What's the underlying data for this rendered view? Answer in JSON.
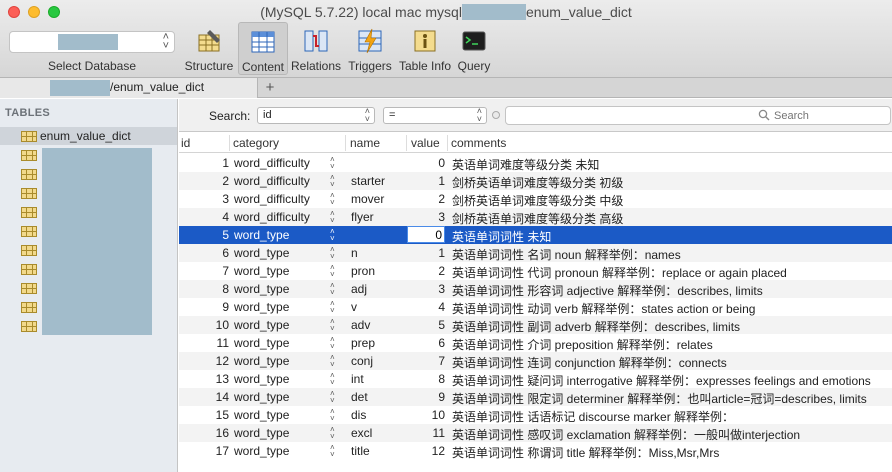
{
  "window": {
    "title_prefix": "(MySQL 5.7.22) local mac mysql",
    "title_suffix": "enum_value_dict"
  },
  "toolbar": {
    "select_database_label": "Select Database",
    "tools": [
      {
        "label": "Structure",
        "icon": "structure-icon"
      },
      {
        "label": "Content",
        "icon": "content-icon",
        "active": true
      },
      {
        "label": "Relations",
        "icon": "relations-icon"
      },
      {
        "label": "Triggers",
        "icon": "triggers-icon"
      },
      {
        "label": "Table Info",
        "icon": "table-info-icon"
      },
      {
        "label": "Query",
        "icon": "query-icon"
      }
    ]
  },
  "tab": {
    "label": "/enum_value_dict",
    "add": "+"
  },
  "sidebar": {
    "heading": "TABLES",
    "selected_table": "enum_value_dict",
    "other_table_count": 11
  },
  "filter": {
    "label": "Search:",
    "field": "id",
    "operator": "=",
    "search_placeholder": "Search"
  },
  "grid": {
    "columns": [
      "id",
      "category",
      "name",
      "value",
      "comments"
    ],
    "selected_row_id": "5",
    "rows": [
      {
        "id": "1",
        "category": "word_difficulty",
        "name": "",
        "value": "0",
        "comments": "英语单词难度等级分类 未知"
      },
      {
        "id": "2",
        "category": "word_difficulty",
        "name": "starter",
        "value": "1",
        "comments": "剑桥英语单词难度等级分类 初级"
      },
      {
        "id": "3",
        "category": "word_difficulty",
        "name": "mover",
        "value": "2",
        "comments": "剑桥英语单词难度等级分类 中级"
      },
      {
        "id": "4",
        "category": "word_difficulty",
        "name": "flyer",
        "value": "3",
        "comments": "剑桥英语单词难度等级分类 高级"
      },
      {
        "id": "5",
        "category": "word_type",
        "name": "",
        "value": "0",
        "comments": "英语单词词性 未知"
      },
      {
        "id": "6",
        "category": "word_type",
        "name": "n",
        "value": "1",
        "comments": "英语单词词性 名词 noun 解释举例：names"
      },
      {
        "id": "7",
        "category": "word_type",
        "name": "pron",
        "value": "2",
        "comments": "英语单词词性 代词 pronoun 解释举例：replace or again placed"
      },
      {
        "id": "8",
        "category": "word_type",
        "name": "adj",
        "value": "3",
        "comments": "英语单词词性 形容词 adjective 解释举例：describes, limits"
      },
      {
        "id": "9",
        "category": "word_type",
        "name": "v",
        "value": "4",
        "comments": "英语单词词性 动词 verb 解释举例：states action or being"
      },
      {
        "id": "10",
        "category": "word_type",
        "name": "adv",
        "value": "5",
        "comments": "英语单词词性 副词 adverb 解释举例：describes, limits"
      },
      {
        "id": "11",
        "category": "word_type",
        "name": "prep",
        "value": "6",
        "comments": "英语单词词性 介词 preposition 解释举例：relates"
      },
      {
        "id": "12",
        "category": "word_type",
        "name": "conj",
        "value": "7",
        "comments": "英语单词词性 连词 conjunction 解释举例：connects"
      },
      {
        "id": "13",
        "category": "word_type",
        "name": "int",
        "value": "8",
        "comments": "英语单词词性 疑问词 interrogative 解释举例：expresses feelings and emotions"
      },
      {
        "id": "14",
        "category": "word_type",
        "name": "det",
        "value": "9",
        "comments": "英语单词词性 限定词 determiner 解释举例：也叫article=冠词=describes, limits"
      },
      {
        "id": "15",
        "category": "word_type",
        "name": "dis",
        "value": "10",
        "comments": "英语单词词性 话语标记 discourse marker 解释举例："
      },
      {
        "id": "16",
        "category": "word_type",
        "name": "excl",
        "value": "11",
        "comments": "英语单词词性 感叹词 exclamation 解释举例：一般叫做interjection"
      },
      {
        "id": "17",
        "category": "word_type",
        "name": "title",
        "value": "12",
        "comments": "英语单词词性 称谓词 title 解释举例：Miss,Msr,Mrs"
      }
    ]
  },
  "colors": {
    "selection": "#1b5ac6",
    "redaction": "#a2bccb",
    "sidebar_bg": "#e7ebf0"
  }
}
